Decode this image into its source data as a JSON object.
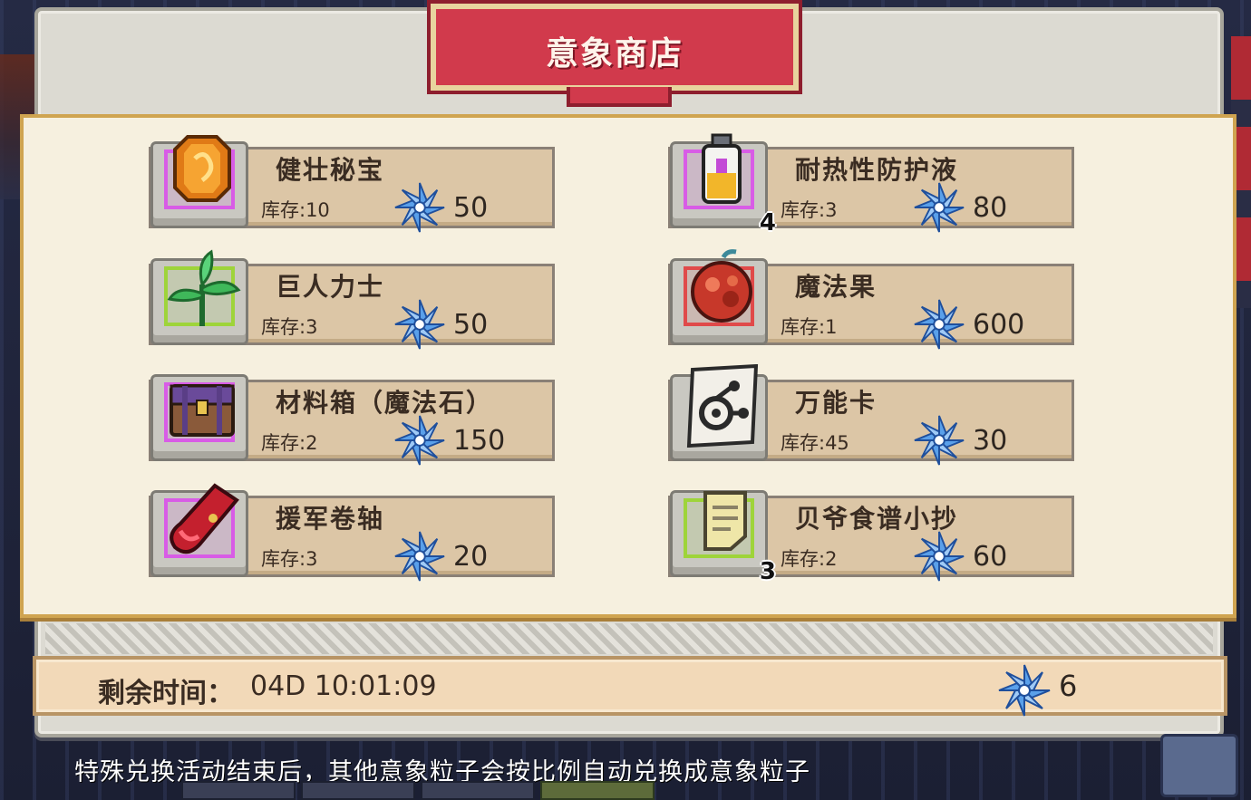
{
  "shop": {
    "title": "意象商店",
    "items": [
      {
        "name": "健壮秘宝",
        "stock": "库存:10",
        "price": "50",
        "icon": "orange-gem-icon",
        "rarity": "purple",
        "count": ""
      },
      {
        "name": "耐热性防护液",
        "stock": "库存:3",
        "price": "80",
        "icon": "potion-bottle-icon",
        "rarity": "purple",
        "count": "4"
      },
      {
        "name": "巨人力士",
        "stock": "库存:3",
        "price": "50",
        "icon": "green-plant-icon",
        "rarity": "green",
        "count": ""
      },
      {
        "name": "魔法果",
        "stock": "库存:1",
        "price": "600",
        "icon": "magic-fruit-icon",
        "rarity": "red",
        "count": ""
      },
      {
        "name": "材料箱（魔法石）",
        "stock": "库存:2",
        "price": "150",
        "icon": "treasure-chest-icon",
        "rarity": "purple",
        "count": ""
      },
      {
        "name": "万能卡",
        "stock": "库存:45",
        "price": "30",
        "icon": "universal-card-icon",
        "rarity": "none",
        "count": ""
      },
      {
        "name": "援军卷轴",
        "stock": "库存:3",
        "price": "20",
        "icon": "red-scroll-icon",
        "rarity": "purple",
        "count": ""
      },
      {
        "name": "贝爷食谱小抄",
        "stock": "库存:2",
        "price": "60",
        "icon": "recipe-note-icon",
        "rarity": "green",
        "count": "3"
      }
    ]
  },
  "footer": {
    "timer_label": "剩余时间：",
    "timer_value": "04D 10:01:09",
    "currency_amount": "6",
    "currency_icon": "pinwheel-crystal-icon"
  },
  "notice": "特殊兑换活动结束后，其他意象粒子会按比例自动兑换成意象粒子",
  "colors": {
    "banner": "#d13a4c",
    "panel": "#f6f0df",
    "rarity_purple": "#d85ce6",
    "rarity_green": "#9ed43a",
    "rarity_red": "#e04a4a",
    "currency": "#4a8fe0"
  }
}
